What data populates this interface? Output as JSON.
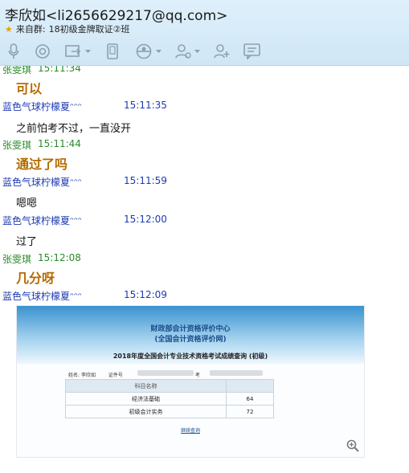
{
  "window": {
    "title": "李欣如<li2656629217@qq.com>",
    "source_label": "来自群:",
    "source_group": "18初级金牌取证②班"
  },
  "toolbar": {
    "icons": [
      "microphone-icon",
      "camera-icon",
      "share-screen-icon",
      "tablet-icon",
      "remote-assist-icon",
      "group-manage-icon",
      "add-friend-icon",
      "message-board-icon"
    ]
  },
  "messages": [
    {
      "sender": "张雯琪",
      "time": "15:11:34",
      "text": "可以"
    },
    {
      "sender": "蓝色气球柠檬夏ᵔᵔᵔ",
      "time": "15:11:35",
      "text": "之前怕考不过，一直没开"
    },
    {
      "sender": "张雯琪",
      "time": "15:11:44",
      "text": "通过了吗"
    },
    {
      "sender": "蓝色气球柠檬夏ᵔᵔᵔ",
      "time": "15:11:59",
      "text": "嗯嗯"
    },
    {
      "sender": "蓝色气球柠檬夏ᵔᵔᵔ",
      "time": "15:12:00",
      "text": "过了"
    },
    {
      "sender": "张雯琪",
      "time": "15:12:08",
      "text": "几分呀"
    },
    {
      "sender": "蓝色气球柠檬夏ᵔᵔᵔ",
      "time": "15:12:09",
      "text": ""
    }
  ],
  "screenshot": {
    "line1": "财政部会计资格评价中心",
    "line2": "(全国会计资格评价网)",
    "line3": "2018年度全国会计专业技术资格考试成绩查询 (初级)",
    "name_label": "姓名:",
    "name_value": "李欣如",
    "id_label": "证件号",
    "exam_label": "考",
    "table_header": "科目名称",
    "rows": [
      {
        "subject": "经济法基础",
        "score": "64"
      },
      {
        "subject": "初级会计实务",
        "score": "72"
      }
    ],
    "link": "继续查询"
  },
  "colors": {
    "blue_sender": "#1c3ab3",
    "green_sender": "#2b8a2b",
    "highlight_text": "#b36b00"
  }
}
